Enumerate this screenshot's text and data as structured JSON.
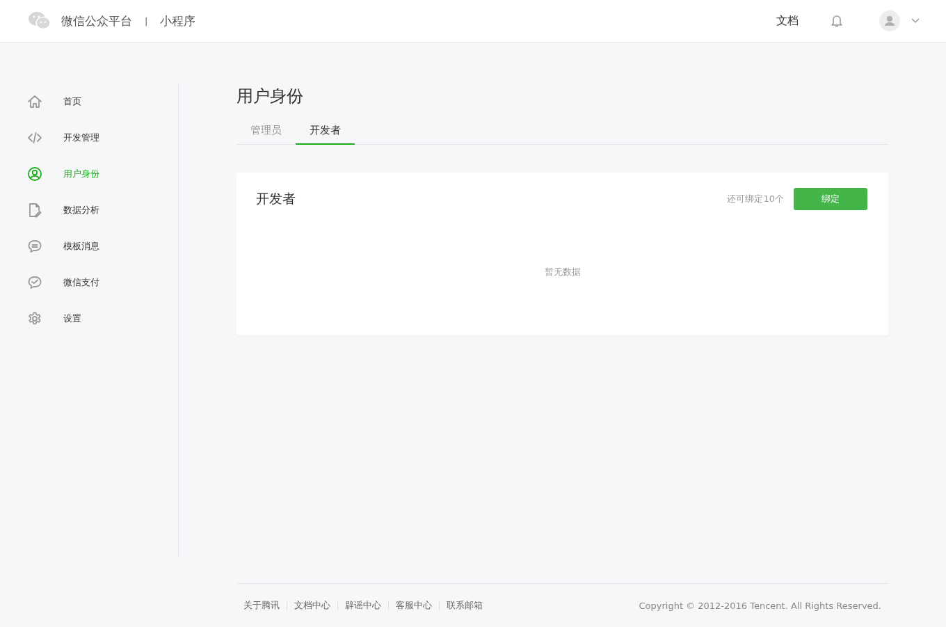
{
  "header": {
    "brand": "微信公众平台",
    "separator": "|",
    "product": "小程序",
    "docs_link": "文档"
  },
  "sidebar": {
    "items": [
      {
        "label": "首页",
        "kind": "home",
        "selected": false
      },
      {
        "label": "开发管理",
        "kind": "code",
        "selected": false
      },
      {
        "label": "用户身份",
        "kind": "user",
        "selected": true
      },
      {
        "label": "数据分析",
        "kind": "doc",
        "selected": false
      },
      {
        "label": "模板消息",
        "kind": "message",
        "selected": false
      },
      {
        "label": "微信支付",
        "kind": "pay",
        "selected": false
      },
      {
        "label": "设置",
        "kind": "settings",
        "selected": false
      }
    ]
  },
  "page_title": "用户身份",
  "tabs": [
    {
      "label": "管理员",
      "selected": false
    },
    {
      "label": "开发者",
      "selected": true
    }
  ],
  "card": {
    "title": "开发者",
    "remaining": "还可绑定10个",
    "bind_button": "绑定",
    "empty_text": "暂无数据"
  },
  "footer": {
    "links": [
      "关于腾讯",
      "文档中心",
      "辟谣中心",
      "客服中心",
      "联系邮箱"
    ],
    "copyright": "Copyright © 2012-2016 Tencent. All Rights Reserved."
  }
}
